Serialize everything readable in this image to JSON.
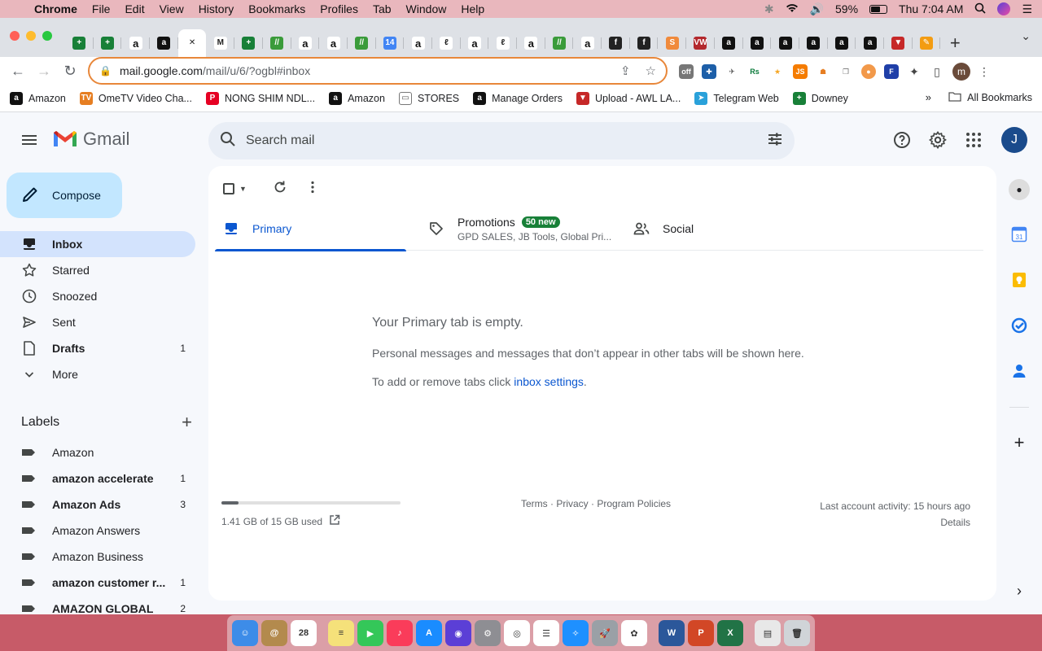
{
  "menubar": {
    "app_name": "Chrome",
    "menus": [
      "File",
      "Edit",
      "View",
      "History",
      "Bookmarks",
      "Profiles",
      "Tab",
      "Window",
      "Help"
    ],
    "battery": "59%",
    "clock": "Thu 7:04 AM"
  },
  "browser": {
    "url_host": "mail.google.com",
    "url_path": "/mail/u/6/?ogbl#inbox",
    "profile_initial": "m",
    "tabs": [
      {
        "icon": "sheets-icon",
        "color": "#188038",
        "glyph": "+"
      },
      {
        "icon": "sheets-icon",
        "color": "#188038",
        "glyph": "+"
      },
      {
        "icon": "amazon-icon",
        "color": "#fff",
        "glyph": "a"
      },
      {
        "icon": "amazon-icon",
        "color": "#111",
        "glyph": "a"
      },
      {
        "icon": "close-icon",
        "color": "#fff",
        "glyph": "✕",
        "active": true
      },
      {
        "icon": "gmail-icon",
        "color": "#fff",
        "glyph": "M"
      },
      {
        "icon": "sheets-icon",
        "color": "#188038",
        "glyph": "+"
      },
      {
        "icon": "walmart-icon",
        "color": "#3a9b3a",
        "glyph": "//"
      },
      {
        "icon": "amazon-icon",
        "color": "#fff",
        "glyph": "a"
      },
      {
        "icon": "amazon-icon",
        "color": "#fff",
        "glyph": "a"
      },
      {
        "icon": "walmart-icon",
        "color": "#3a9b3a",
        "glyph": "//"
      },
      {
        "icon": "badge-icon",
        "color": "#4285f4",
        "glyph": "14"
      },
      {
        "icon": "amazon-icon",
        "color": "#fff",
        "glyph": "a"
      },
      {
        "icon": "leaf-icon",
        "color": "#fff",
        "glyph": "ℓ"
      },
      {
        "icon": "amazon-icon",
        "color": "#fff",
        "glyph": "a"
      },
      {
        "icon": "leaf-icon",
        "color": "#fff",
        "glyph": "ℓ"
      },
      {
        "icon": "amazon-icon",
        "color": "#fff",
        "glyph": "a"
      },
      {
        "icon": "walmart-icon",
        "color": "#3a9b3a",
        "glyph": "//"
      },
      {
        "icon": "amazon-icon",
        "color": "#fff",
        "glyph": "a"
      },
      {
        "icon": "fiverr-icon",
        "color": "#222",
        "glyph": "f"
      },
      {
        "icon": "fiverr-icon",
        "color": "#222",
        "glyph": "f"
      },
      {
        "icon": "orange-icon",
        "color": "#f08a3c",
        "glyph": "S"
      },
      {
        "icon": "vw-icon",
        "color": "#b3282d",
        "glyph": "VW"
      },
      {
        "icon": "amazon-icon",
        "color": "#111",
        "glyph": "a"
      },
      {
        "icon": "amazon-icon",
        "color": "#111",
        "glyph": "a"
      },
      {
        "icon": "amazon-icon",
        "color": "#111",
        "glyph": "a"
      },
      {
        "icon": "amazon-icon",
        "color": "#111",
        "glyph": "a"
      },
      {
        "icon": "amazon-icon",
        "color": "#111",
        "glyph": "a"
      },
      {
        "icon": "amazon-icon",
        "color": "#111",
        "glyph": "a"
      },
      {
        "icon": "awl-icon",
        "color": "#c62828",
        "glyph": "▼"
      },
      {
        "icon": "pencil-tab-icon",
        "color": "#f39c12",
        "glyph": "✎"
      }
    ]
  },
  "bookmarks": [
    {
      "label": "Amazon",
      "icon": "amazon-icon",
      "color": "#111",
      "glyph": "a"
    },
    {
      "label": "OmeTV Video Cha...",
      "icon": "ometv-icon",
      "color": "#e67e22",
      "glyph": "TV"
    },
    {
      "label": "NONG SHIM NDL...",
      "icon": "pinterest-icon",
      "color": "#e60023",
      "glyph": "P"
    },
    {
      "label": "Amazon",
      "icon": "amazon-icon",
      "color": "#111",
      "glyph": "a"
    },
    {
      "label": "STORES",
      "icon": "folder-icon",
      "color": "#fff",
      "glyph": "▭"
    },
    {
      "label": "Manage Orders",
      "icon": "amazon-icon",
      "color": "#111",
      "glyph": "a"
    },
    {
      "label": "Upload - AWL LA...",
      "icon": "awl-icon",
      "color": "#c62828",
      "glyph": "▼"
    },
    {
      "label": "Telegram Web",
      "icon": "telegram-icon",
      "color": "#2aa1da",
      "glyph": "➤"
    },
    {
      "label": "Downey",
      "icon": "sheets-icon",
      "color": "#188038",
      "glyph": "+"
    }
  ],
  "bookmarks_more": "»",
  "all_bookmarks": "All Bookmarks",
  "gmail": {
    "logo_text": "Gmail",
    "search_placeholder": "Search mail",
    "account_initial": "J",
    "compose_label": "Compose",
    "nav": [
      {
        "label": "Inbox",
        "icon": "inbox-icon",
        "count": "",
        "active": true,
        "bold": true
      },
      {
        "label": "Starred",
        "icon": "star-icon",
        "count": ""
      },
      {
        "label": "Snoozed",
        "icon": "clock-icon",
        "count": ""
      },
      {
        "label": "Sent",
        "icon": "send-icon",
        "count": ""
      },
      {
        "label": "Drafts",
        "icon": "file-icon",
        "count": "1",
        "bold": true
      },
      {
        "label": "More",
        "icon": "chevron-down-icon",
        "count": ""
      }
    ],
    "labels_heading": "Labels",
    "labels": [
      {
        "label": "Amazon",
        "count": "",
        "bold": false
      },
      {
        "label": "amazon accelerate",
        "count": "1",
        "bold": true
      },
      {
        "label": "Amazon Ads",
        "count": "3",
        "bold": true
      },
      {
        "label": "Amazon Answers",
        "count": "",
        "bold": false
      },
      {
        "label": "Amazon Business",
        "count": "",
        "bold": false
      },
      {
        "label": "amazon customer r...",
        "count": "1",
        "bold": true
      },
      {
        "label": "AMAZON GLOBAL",
        "count": "2",
        "bold": true
      }
    ],
    "tabs": {
      "primary": "Primary",
      "promotions": "Promotions",
      "promotions_badge": "50 new",
      "promotions_senders": "GPD SALES, JB Tools, Global Pri...",
      "social": "Social"
    },
    "empty": {
      "heading": "Your Primary tab is empty.",
      "body": "Personal messages and messages that don’t appear in other tabs will be shown here.",
      "settings_prefix": "To add or remove tabs click ",
      "settings_link": "inbox settings",
      "settings_suffix": "."
    },
    "footer": {
      "storage": "1.41 GB of 15 GB used",
      "storage_fraction": 0.094,
      "terms": "Terms",
      "privacy": "Privacy",
      "policies": "Program Policies",
      "sep": " · ",
      "activity": "Last account activity: 15 hours ago",
      "details": "Details"
    },
    "calendar_day": "31"
  },
  "dock": [
    {
      "icon": "finder-icon",
      "color": "#3d8ce8",
      "glyph": "☺"
    },
    {
      "icon": "contacts-icon",
      "color": "#b38a4d",
      "glyph": "@"
    },
    {
      "icon": "calendar-icon",
      "color": "#fff",
      "glyph": "28"
    },
    {
      "icon": "notes-icon",
      "color": "#f5e17a",
      "glyph": "≡"
    },
    {
      "icon": "facetime-icon",
      "color": "#34c759",
      "glyph": "▶"
    },
    {
      "icon": "music-icon",
      "color": "#fa3c5a",
      "glyph": "♪"
    },
    {
      "icon": "app-store-icon",
      "color": "#1a8cff",
      "glyph": "A"
    },
    {
      "icon": "siri-icon",
      "color": "#5b3fd6",
      "glyph": "◉"
    },
    {
      "icon": "system-preferences-icon",
      "color": "#8e8e93",
      "glyph": "⚙"
    },
    {
      "icon": "chrome-icon",
      "color": "#fff",
      "glyph": "◎"
    },
    {
      "icon": "reminders-icon",
      "color": "#fff",
      "glyph": "☰"
    },
    {
      "icon": "safari-icon",
      "color": "#1e90ff",
      "glyph": "✧"
    },
    {
      "icon": "launchpad-icon",
      "color": "#9aa0a6",
      "glyph": "🚀"
    },
    {
      "icon": "photos-icon",
      "color": "#fff",
      "glyph": "✿"
    },
    {
      "icon": "word-icon",
      "color": "#2b579a",
      "glyph": "W"
    },
    {
      "icon": "powerpoint-icon",
      "color": "#d24726",
      "glyph": "P"
    },
    {
      "icon": "excel-icon",
      "color": "#217346",
      "glyph": "X"
    },
    {
      "icon": "documents-icon",
      "color": "#e8e8e8",
      "glyph": "▤"
    },
    {
      "icon": "trash-icon",
      "color": "#d0d4d8",
      "glyph": "🗑"
    }
  ]
}
